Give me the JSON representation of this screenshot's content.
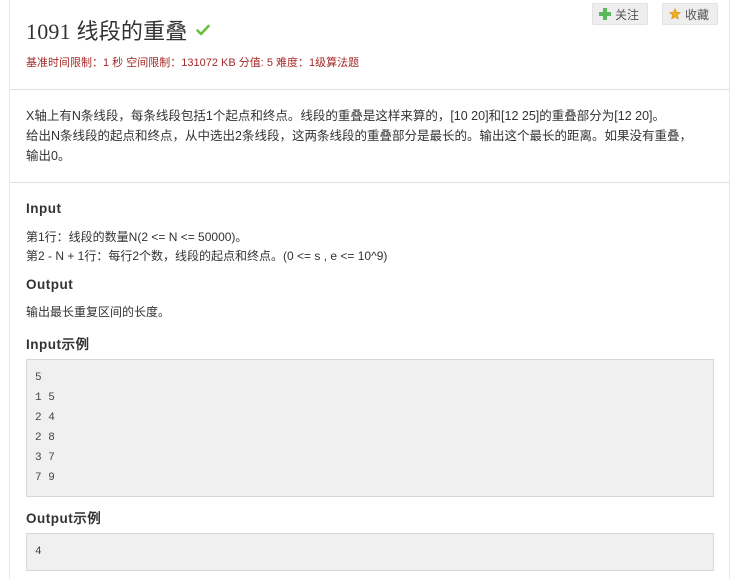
{
  "problem": {
    "title": "1091 线段的重叠",
    "meta": "基准时间限制：1 秒 空间限制：131072 KB 分值: 5 难度：1级算法题",
    "description": [
      "X轴上有N条线段，每条线段包括1个起点和终点。线段的重叠是这样来算的，[10 20]和[12 25]的重叠部分为[12 20]。",
      "给出N条线段的起点和终点，从中选出2条线段，这两条线段的重叠部分是最长的。输出这个最长的距离。如果没有重叠，",
      "输出0。"
    ]
  },
  "buttons": {
    "follow_label": "关注",
    "favorite_label": "收藏"
  },
  "sections": {
    "input_title": "Input",
    "input_lines": [
      "第1行：线段的数量N(2 <= N <= 50000)。",
      "第2 - N + 1行：每行2个数，线段的起点和终点。(0 <= s , e <= 10^9)"
    ],
    "output_title": "Output",
    "output_text": "输出最长重复区间的长度。",
    "input_example_title": "Input示例",
    "input_example": [
      "5",
      "1 5",
      "2 4",
      "2 8",
      "3 7",
      "7 9"
    ],
    "output_example_title": "Output示例",
    "output_example": [
      "4"
    ]
  },
  "colors": {
    "meta": "#a52a2a",
    "check": "#6abf3c",
    "plus": "#5cb85c",
    "star": "#f0ad1e"
  }
}
